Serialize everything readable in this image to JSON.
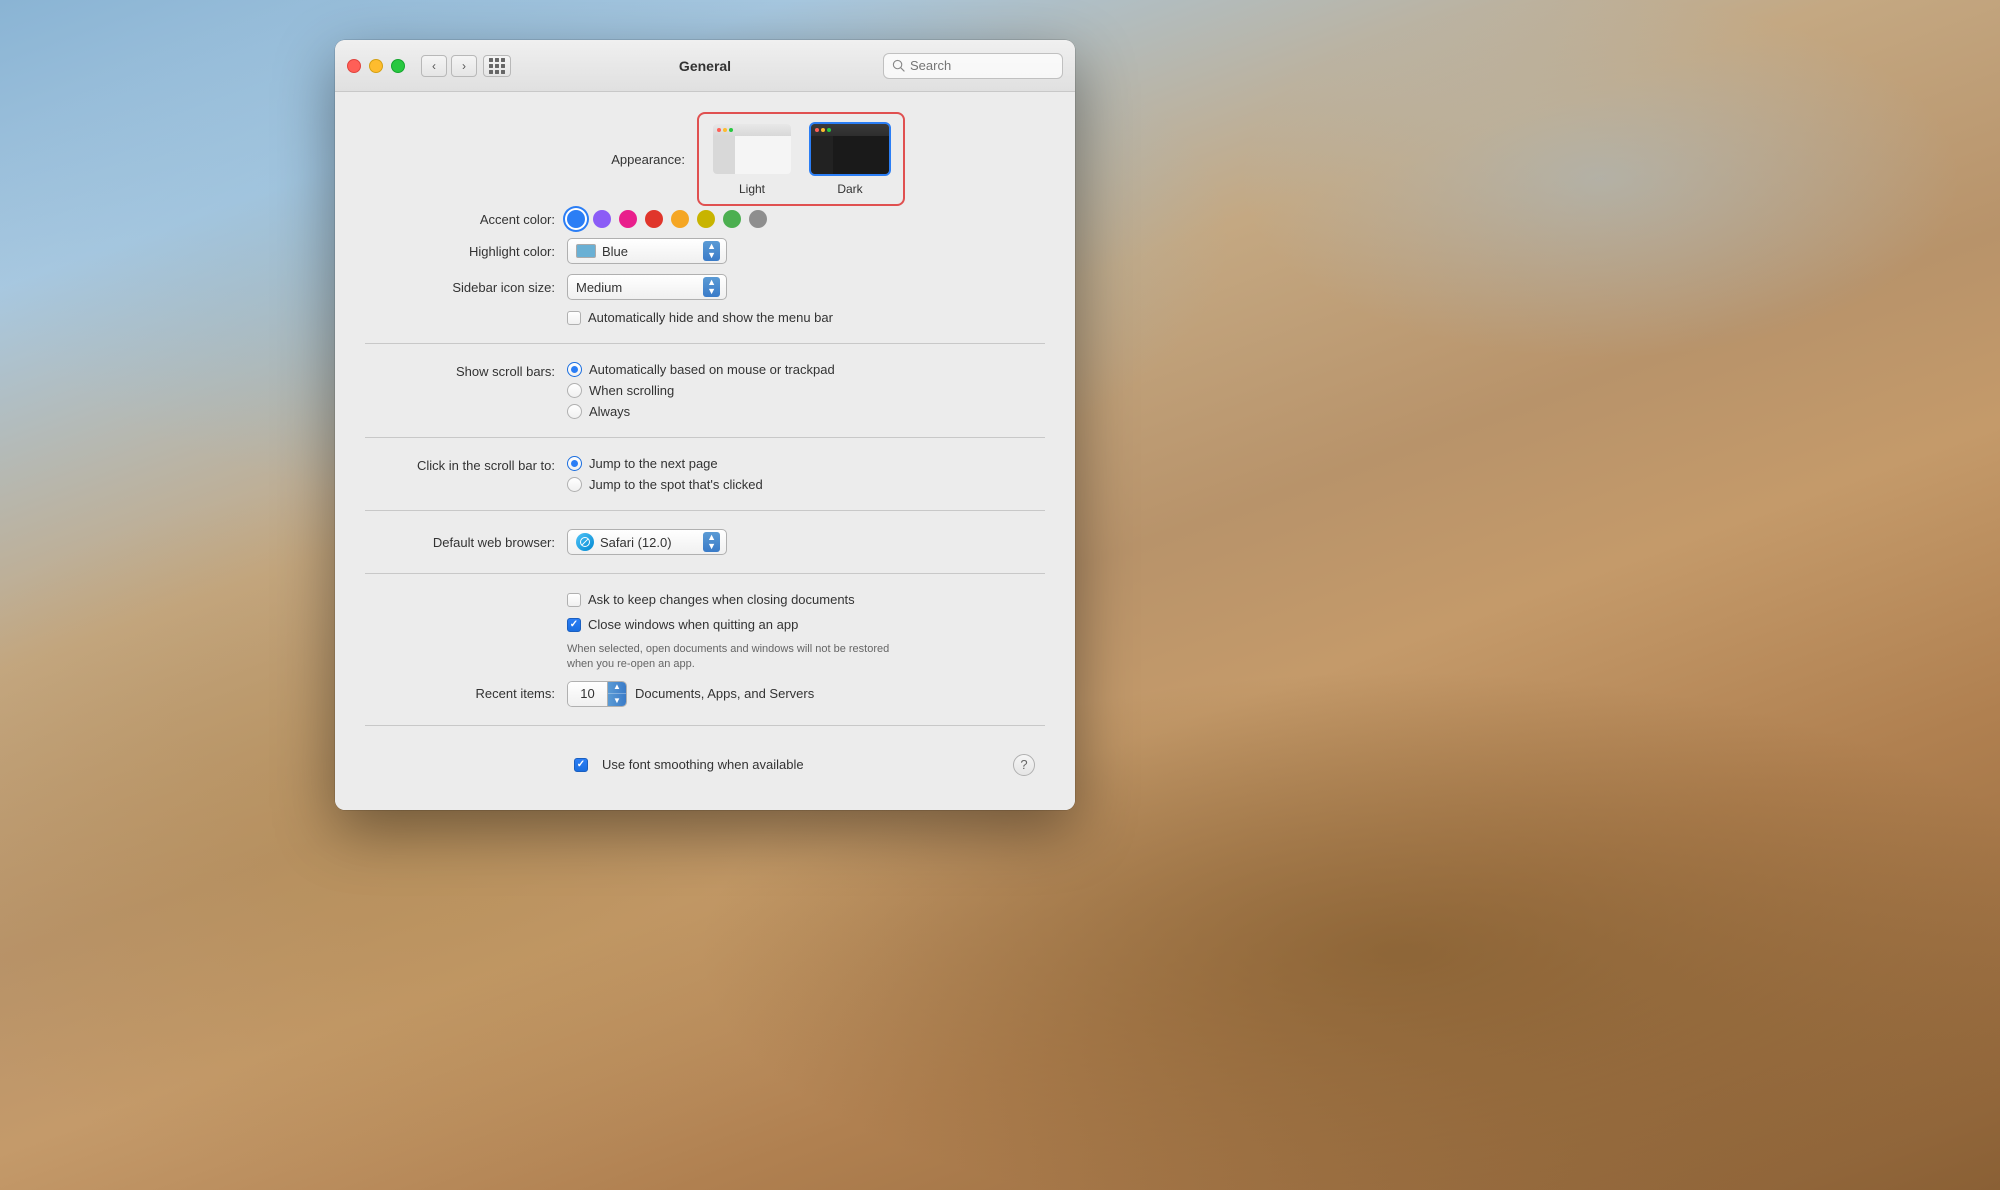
{
  "desktop": {
    "background_description": "macOS Mojave desert landscape"
  },
  "window": {
    "title": "General",
    "traffic_lights": {
      "close": "close",
      "minimize": "minimize",
      "fullscreen": "fullscreen"
    },
    "search_placeholder": "Search"
  },
  "appearance": {
    "label": "Appearance:",
    "options": [
      {
        "id": "light",
        "name": "Light"
      },
      {
        "id": "dark",
        "name": "Dark"
      }
    ],
    "selected": "dark"
  },
  "accent_color": {
    "label": "Accent color:",
    "colors": [
      {
        "id": "blue",
        "hex": "#2b7ef5",
        "selected": true
      },
      {
        "id": "purple",
        "hex": "#8b5cf6"
      },
      {
        "id": "pink",
        "hex": "#e91e8c"
      },
      {
        "id": "red",
        "hex": "#e0352b"
      },
      {
        "id": "orange",
        "hex": "#f5a623"
      },
      {
        "id": "yellow",
        "hex": "#d4c000"
      },
      {
        "id": "green",
        "hex": "#4caf50"
      },
      {
        "id": "graphite",
        "hex": "#8e8e8e"
      }
    ]
  },
  "highlight_color": {
    "label": "Highlight color:",
    "value": "Blue",
    "swatch_color": "#6ab0d4"
  },
  "sidebar_icon_size": {
    "label": "Sidebar icon size:",
    "value": "Medium"
  },
  "auto_hide_menu_bar": {
    "label": "Automatically hide and show the menu bar",
    "checked": false
  },
  "show_scroll_bars": {
    "label": "Show scroll bars:",
    "options": [
      {
        "id": "auto",
        "label": "Automatically based on mouse or trackpad",
        "selected": true
      },
      {
        "id": "scrolling",
        "label": "When scrolling",
        "selected": false
      },
      {
        "id": "always",
        "label": "Always",
        "selected": false
      }
    ]
  },
  "click_scroll_bar": {
    "label": "Click in the scroll bar to:",
    "options": [
      {
        "id": "next_page",
        "label": "Jump to the next page",
        "selected": true
      },
      {
        "id": "spot",
        "label": "Jump to the spot that's clicked",
        "selected": false
      }
    ]
  },
  "default_browser": {
    "label": "Default web browser:",
    "value": "Safari (12.0)"
  },
  "ask_keep_changes": {
    "label": "Ask to keep changes when closing documents",
    "checked": false
  },
  "close_windows": {
    "label": "Close windows when quitting an app",
    "checked": true,
    "subtext": "When selected, open documents and windows will not be restored\nwhen you re-open an app."
  },
  "recent_items": {
    "label": "Recent items:",
    "value": "10",
    "suffix": "Documents, Apps, and Servers"
  },
  "font_smoothing": {
    "label": "Use font smoothing when available",
    "checked": true
  }
}
